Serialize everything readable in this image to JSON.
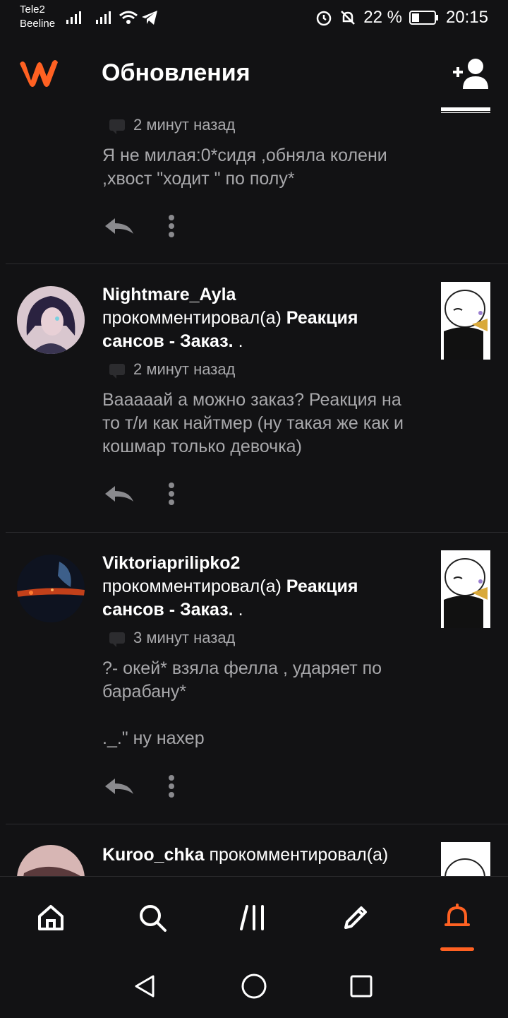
{
  "status_bar": {
    "carrier1": "Tele2",
    "carrier2": "Beeline",
    "battery": "22 %",
    "time": "20:15"
  },
  "header": {
    "title": "Обновления"
  },
  "feed": [
    {
      "partial": true,
      "time": "2 минут назад",
      "text": "Я не милая:0*сидя ,обняла колени ,хвост \"ходит \" по полу*"
    },
    {
      "user": "Nightmare_Ayla",
      "action": "прокомментировал(а)",
      "story": "Реакция сансов - Заказ.",
      "suffix": ".",
      "time": "2 минут назад",
      "text": "Вааааай а можно заказ? Реакция на то т/и как найтмер (ну такая же как и кошмар только девочка)"
    },
    {
      "user": "Viktoriaprilipko2",
      "action": "прокомментировал(а)",
      "story": "Реакция сансов - Заказ.",
      "suffix": ".",
      "time": "3 минут назад",
      "text": "?- окей* взяла фелла , ударяет по барабану*\n\n._.\" ну нахер"
    },
    {
      "user": "Kuroo_chka",
      "action": "прокомментировал(а)",
      "partial": true
    }
  ],
  "bottom_nav": {
    "items": [
      "home-icon",
      "search-icon",
      "library-icon",
      "write-icon",
      "notifications-icon"
    ],
    "active": "notifications-icon"
  },
  "colors": {
    "background": "#121214",
    "accent": "#ff6122",
    "secondary_text": "#a8a8ab",
    "divider": "#2c2c2f"
  }
}
